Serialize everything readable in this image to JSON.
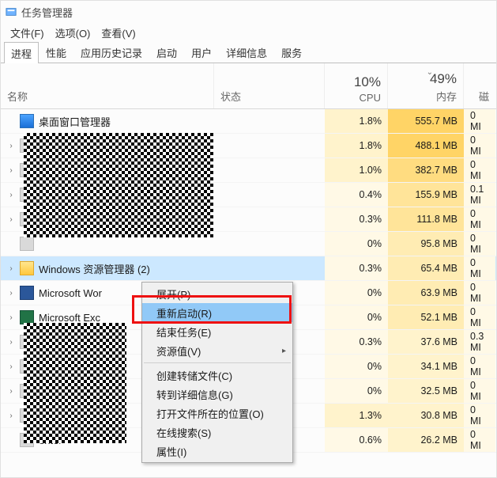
{
  "window": {
    "title": "任务管理器"
  },
  "menu": {
    "file": "文件(F)",
    "options": "选项(O)",
    "view": "查看(V)"
  },
  "tabs": {
    "processes": "进程",
    "performance": "性能",
    "app_history": "应用历史记录",
    "startup": "启动",
    "users": "用户",
    "details": "详细信息",
    "services": "服务"
  },
  "columns": {
    "name": "名称",
    "status": "状态",
    "cpu_pct": "10%",
    "cpu_lbl": "CPU",
    "mem_pct": "49%",
    "mem_lbl": "内存",
    "disk_lbl": "磁"
  },
  "rows": [
    {
      "name": "桌面窗口管理器",
      "icon": "dwm",
      "exp": false,
      "cpu": "1.8%",
      "cpu_h": "h1",
      "mem": "555.7 MB",
      "mem_h": "h5",
      "disk": "0 MI"
    },
    {
      "name": "",
      "icon": "generic",
      "exp": true,
      "cpu": "1.8%",
      "cpu_h": "h1",
      "mem": "488.1 MB",
      "mem_h": "h5",
      "disk": "0 MI"
    },
    {
      "name": "",
      "icon": "generic",
      "exp": true,
      "cpu": "1.0%",
      "cpu_h": "h1",
      "mem": "382.7 MB",
      "mem_h": "h4",
      "disk": "0 MI"
    },
    {
      "name": "",
      "icon": "generic",
      "exp": true,
      "cpu": "0.4%",
      "cpu_h": "h0",
      "mem": "155.9 MB",
      "mem_h": "h3",
      "disk": "0.1 MI"
    },
    {
      "name": "",
      "icon": "generic",
      "exp": true,
      "cpu": "0.3%",
      "cpu_h": "h0",
      "mem": "111.8 MB",
      "mem_h": "h3",
      "disk": "0 MI"
    },
    {
      "name": "",
      "icon": "generic",
      "exp": false,
      "cpu": "0%",
      "cpu_h": "h0",
      "mem": "95.8 MB",
      "mem_h": "h2",
      "disk": "0 MI"
    },
    {
      "name": "Windows 资源管理器 (2)",
      "icon": "folder",
      "exp": true,
      "sel": true,
      "cpu": "0.3%",
      "cpu_h": "h0",
      "mem": "65.4 MB",
      "mem_h": "h2",
      "disk": "0 MI"
    },
    {
      "name": "Microsoft Wor",
      "icon": "word",
      "exp": true,
      "cpu": "0%",
      "cpu_h": "h0",
      "mem": "63.9 MB",
      "mem_h": "h2",
      "disk": "0 MI"
    },
    {
      "name": "Microsoft Exc",
      "icon": "excel",
      "exp": true,
      "cpu": "0%",
      "cpu_h": "h0",
      "mem": "52.1 MB",
      "mem_h": "h2",
      "disk": "0 MI"
    },
    {
      "name": "",
      "icon": "generic",
      "exp": true,
      "cpu": "0.3%",
      "cpu_h": "h0",
      "mem": "37.6 MB",
      "mem_h": "h1",
      "disk": "0.3 MI"
    },
    {
      "name": "",
      "icon": "generic",
      "exp": true,
      "cpu": "0%",
      "cpu_h": "h0",
      "mem": "34.1 MB",
      "mem_h": "h1",
      "disk": "0 MI"
    },
    {
      "name": "",
      "icon": "generic",
      "exp": true,
      "cpu": "0%",
      "cpu_h": "h0",
      "mem": "32.5 MB",
      "mem_h": "h1",
      "disk": "0 MI"
    },
    {
      "name": "",
      "icon": "generic",
      "exp": true,
      "cpu": "1.3%",
      "cpu_h": "h1",
      "mem": "30.8 MB",
      "mem_h": "h1",
      "disk": "0 MI"
    },
    {
      "name": "enter",
      "icon": "generic",
      "exp": false,
      "cpu": "0.6%",
      "cpu_h": "h0",
      "mem": "26.2 MB",
      "mem_h": "h1",
      "disk": "0 MI"
    }
  ],
  "context_menu": {
    "expand": "展开(P)",
    "restart": "重新启动(R)",
    "end_task": "结束任务(E)",
    "resource_vals": "资源值(V)",
    "create_dump": "创建转储文件(C)",
    "go_details": "转到详细信息(G)",
    "open_location": "打开文件所在的位置(O)",
    "search_online": "在线搜索(S)",
    "properties": "属性(I)"
  }
}
